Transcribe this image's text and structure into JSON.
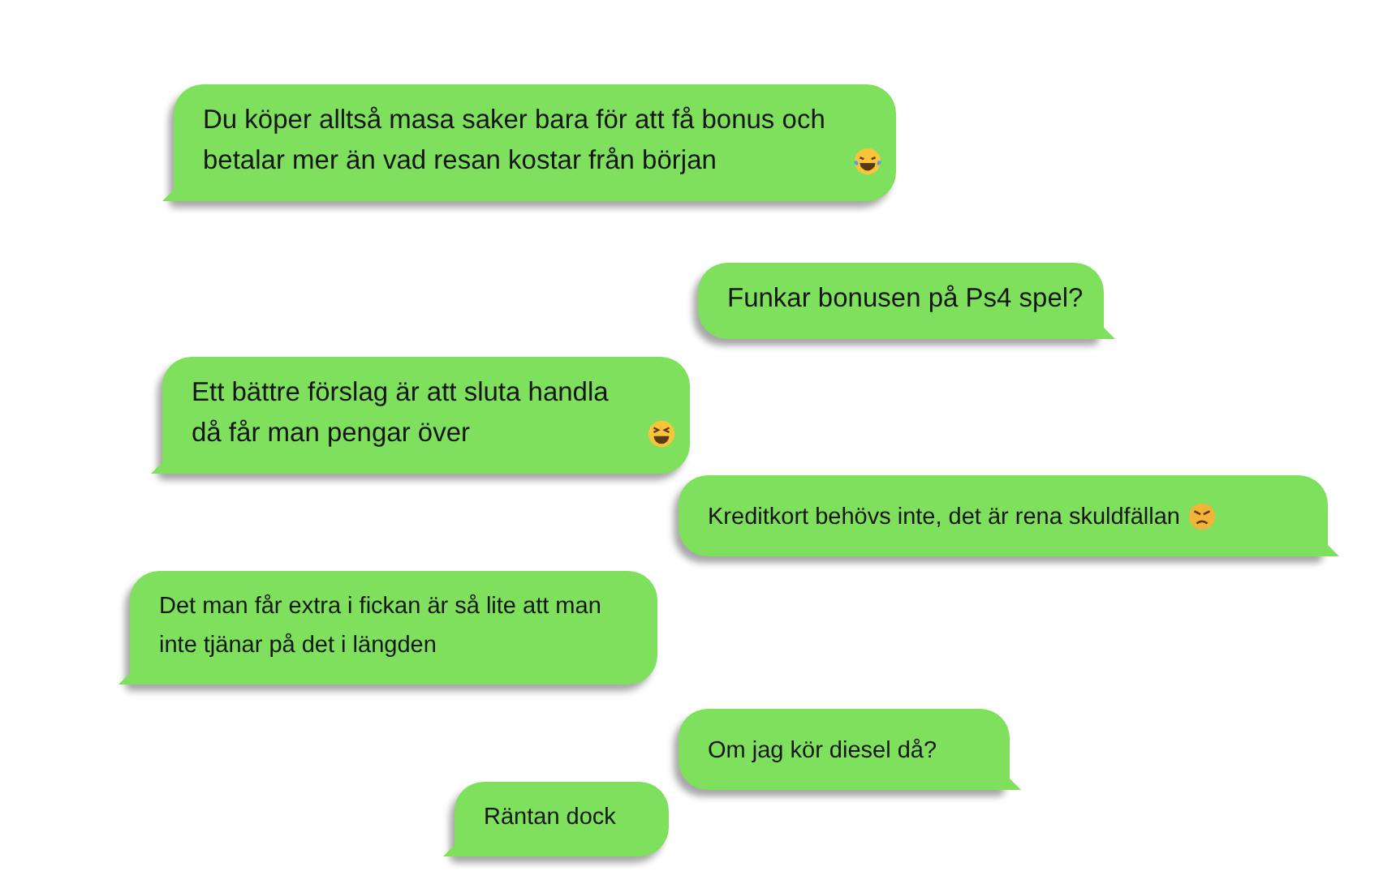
{
  "messages": [
    {
      "text": "Du köper alltså masa saker bara för att få bonus och betalar mer än vad resan kostar från början",
      "kind": "left",
      "emoji": {
        "kind": "tears-of-joy"
      }
    },
    {
      "text": "Funkar bonusen på Ps4 spel?",
      "kind": "right"
    },
    {
      "text": "Ett bättre förslag är att sluta handla då får man pengar över",
      "kind": "left",
      "emoji": {
        "kind": "squint-grin"
      }
    },
    {
      "text": "Kreditkort behövs inte, det är rena skuldfällan",
      "kind": "right",
      "emoji": {
        "kind": "angry"
      }
    },
    {
      "text": "Det man får extra i fickan är så lite att man inte tjänar på det i längden",
      "kind": "left"
    },
    {
      "text": "Om jag kör diesel då?",
      "kind": "right"
    },
    {
      "text": "Räntan dock",
      "kind": "left"
    }
  ]
}
